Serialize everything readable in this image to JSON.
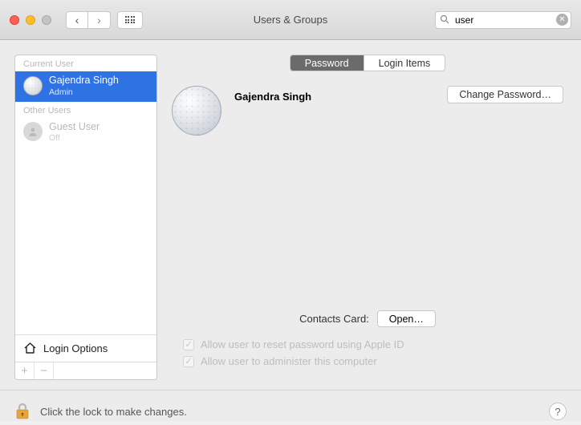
{
  "window": {
    "title": "Users & Groups"
  },
  "search": {
    "value": "user"
  },
  "sidebar": {
    "section_current": "Current User",
    "section_other": "Other Users",
    "current_user": {
      "name": "Gajendra Singh",
      "role": "Admin"
    },
    "other_user": {
      "name": "Guest User",
      "role": "Off"
    },
    "login_options": "Login Options"
  },
  "tabs": {
    "password": "Password",
    "login_items": "Login Items"
  },
  "profile": {
    "name": "Gajendra Singh",
    "change_password": "Change Password…"
  },
  "contacts": {
    "label": "Contacts Card:",
    "open": "Open…"
  },
  "options": {
    "reset_apple_id": "Allow user to reset password using Apple ID",
    "admin": "Allow user to administer this computer"
  },
  "footer": {
    "text": "Click the lock to make changes."
  }
}
